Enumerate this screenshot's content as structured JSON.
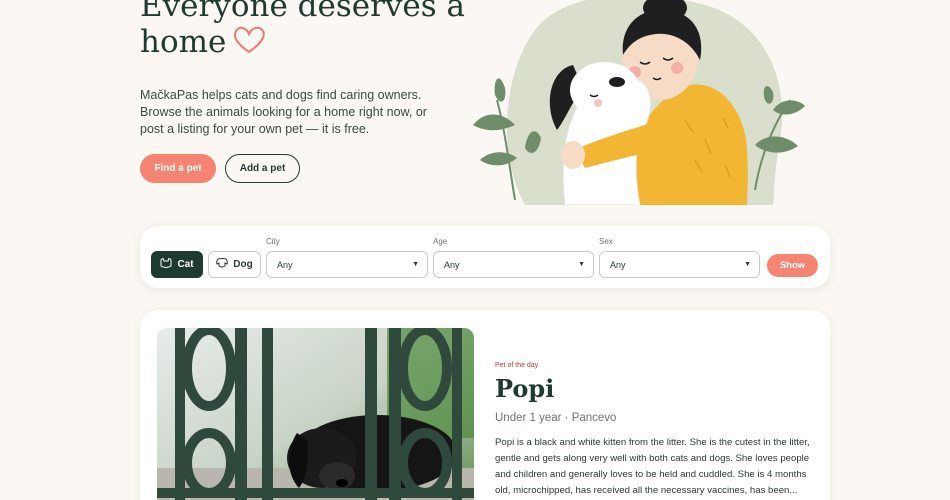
{
  "hero": {
    "title": "Everyone deserves a home",
    "description": "MačkaPas helps cats and dogs find caring owners. Browse the animals looking for a home right now, or post a listing for your own pet — it is free.",
    "find_button": "Find a pet",
    "add_button": "Add a pet"
  },
  "filters": {
    "cat_label": "Cat",
    "dog_label": "Dog",
    "city_label": "City",
    "city_value": "Any",
    "age_label": "Age",
    "age_value": "Any",
    "sex_label": "Sex",
    "sex_value": "Any",
    "show_button": "Show"
  },
  "pet_of_day": {
    "kicker": "Pet of the day",
    "name": "Popi",
    "meta": "Under 1 year · Pancevo",
    "description": "Popi is a black and white kitten from the litter. She is the cutest in the litter, gentle and gets along very well with both cats and dogs. She loves people and children and generally loves to be held and cuddled. She is 4 months old, microchipped, has received all the necessary vaccines, has been..."
  },
  "colors": {
    "accent": "#f58472",
    "dark": "#1f3a30",
    "background": "#fbf7f2"
  }
}
